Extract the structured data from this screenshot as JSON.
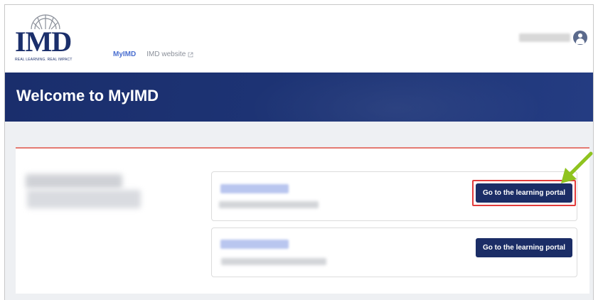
{
  "logo": {
    "text": "IMD",
    "tagline": "REAL LEARNING. REAL IMPACT"
  },
  "nav": {
    "items": [
      {
        "label": "MyIMD",
        "active": true
      },
      {
        "label": "IMD website",
        "icon": "external-link-icon"
      }
    ]
  },
  "user": {
    "avatar_icon": "user-avatar-icon"
  },
  "banner": {
    "title": "Welcome to MyIMD"
  },
  "cards": [
    {
      "button_label": "Go to the learning portal",
      "highlighted": true
    },
    {
      "button_label": "Go to the learning portal",
      "highlighted": false
    }
  ],
  "colors": {
    "brand_navy": "#1b2d66",
    "nav_active": "#4a6fd0",
    "divider_accent": "#e47a72",
    "highlight_box": "#e23b3b",
    "annotation_arrow": "#8fc31f"
  }
}
